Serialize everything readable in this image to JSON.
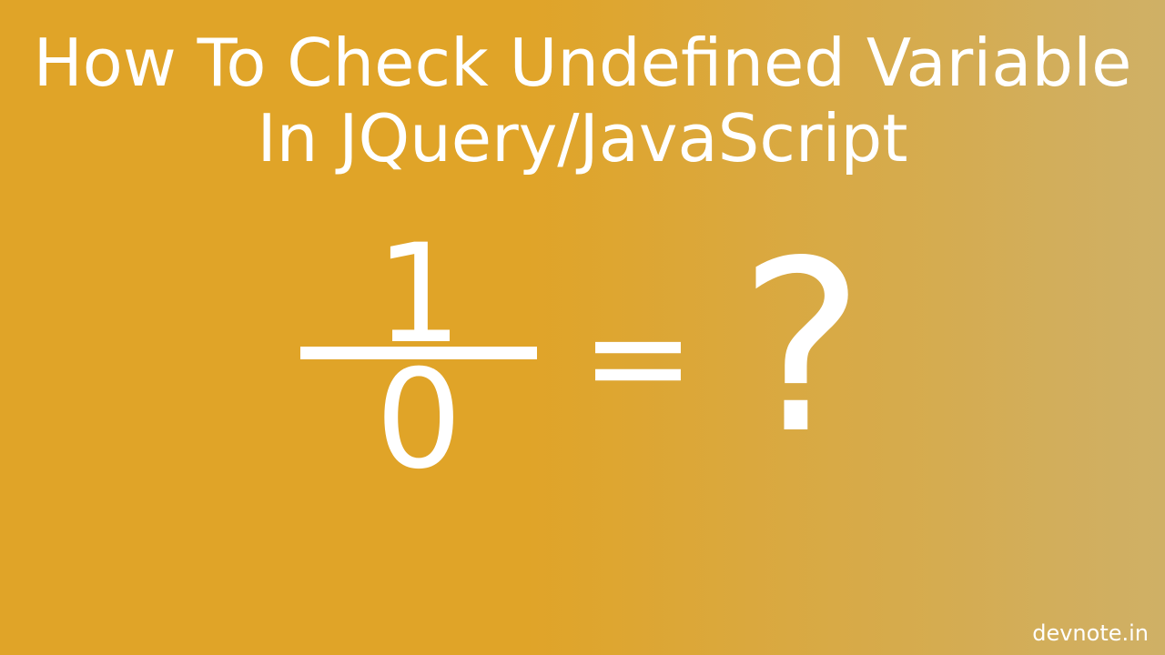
{
  "title": {
    "line1": "How To Check Undefined Variable",
    "line2": "In JQuery/JavaScript"
  },
  "equation": {
    "numerator": "1",
    "denominator": "0",
    "equals": "=",
    "result": "?"
  },
  "watermark": "devnote.in"
}
